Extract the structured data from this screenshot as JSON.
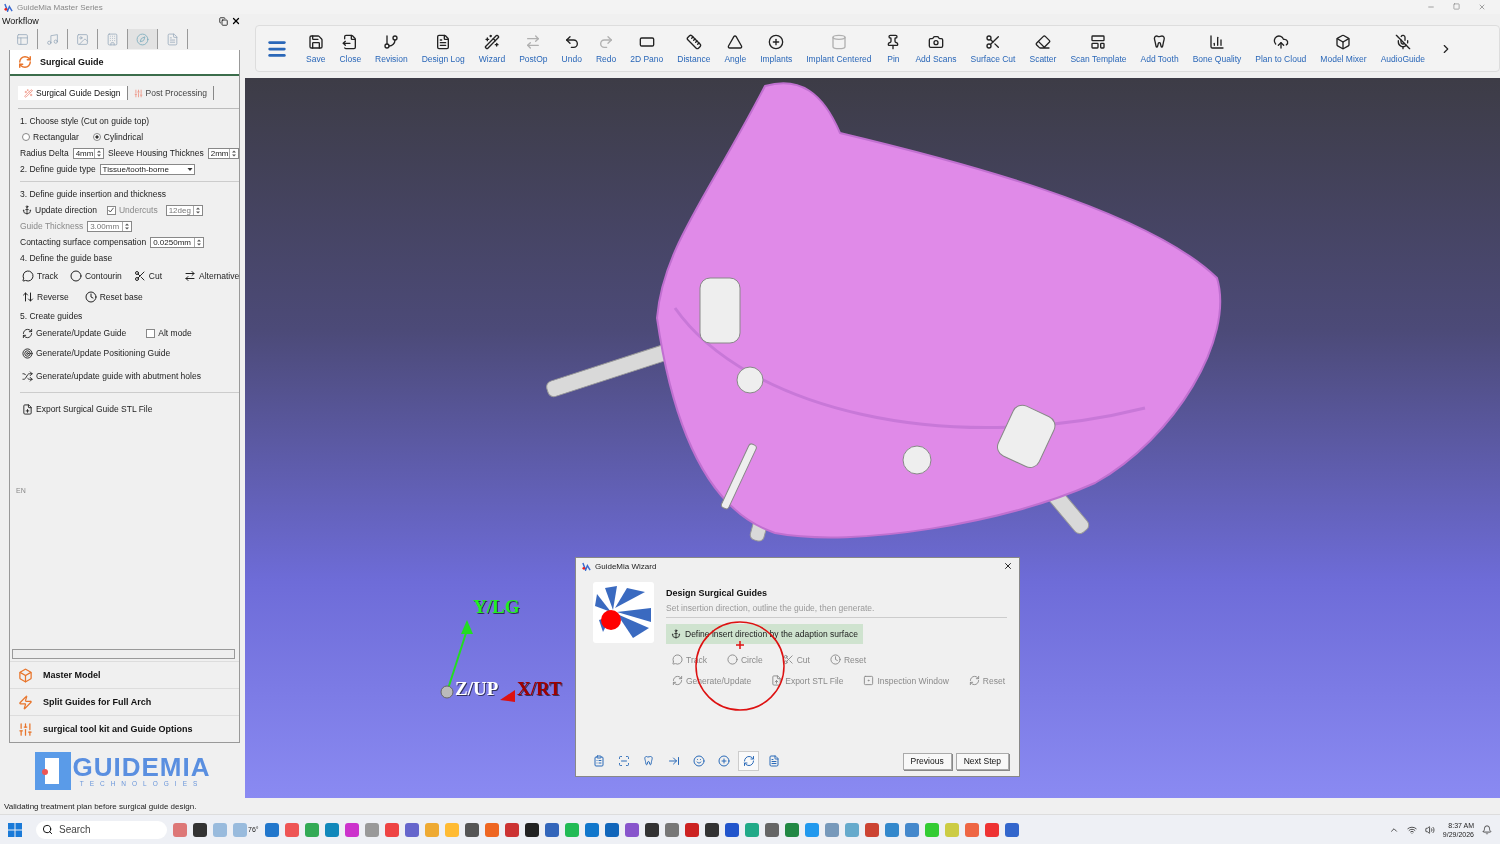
{
  "window": {
    "title": "GuideMia Master Series"
  },
  "workflow": {
    "title": "Workflow",
    "tabs": [
      {
        "selected": false
      },
      {
        "selected": false
      },
      {
        "selected": false
      },
      {
        "selected": false
      },
      {
        "selected": true
      },
      {
        "selected": false
      }
    ],
    "section_title": "Surgical Guide",
    "subtabs": [
      {
        "label": "Surgical Guide Design",
        "selected": true
      },
      {
        "label": "Post Processing",
        "selected": false
      }
    ],
    "step1": {
      "heading": "1. Choose  style (Cut on guide top)",
      "radios": [
        {
          "label": "Rectangular",
          "selected": false
        },
        {
          "label": "Cylindrical",
          "selected": true
        }
      ],
      "radius_delta": {
        "label": "Radius Delta",
        "value": "4mm"
      },
      "sleeve_housing": {
        "label": "Sleeve Housing Thicknes",
        "value": "2mm"
      }
    },
    "step2": {
      "heading": "2. Define guide type",
      "value": "Tissue/tooth-borne"
    },
    "step3": {
      "heading": "3. Define guide insertion and thickness",
      "update_button": "Update direction",
      "undercuts": {
        "label": "Undercuts",
        "checked": true,
        "disabled": true,
        "value": "12deg"
      },
      "guide_thickness": {
        "label": "Guide Thickness",
        "value": "3.00mm",
        "disabled": true
      },
      "compensation": {
        "label": "Contacting surface compensation",
        "value": "0.0250mm"
      }
    },
    "step4": {
      "heading": "4. Define the guide base",
      "tools": [
        {
          "label": "Track"
        },
        {
          "label": "Contourin"
        },
        {
          "label": "Cut"
        },
        {
          "label": "Alternative"
        }
      ],
      "tools2": [
        {
          "label": "Reverse"
        },
        {
          "label": "Reset base"
        }
      ]
    },
    "step5": {
      "heading": "5. Create guides",
      "generate": "Generate/Update Guide",
      "alt_mode": {
        "label": "Alt mode",
        "checked": false
      },
      "positioning": "Generate/Update Positioning Guide",
      "abutment": "Generate/update guide with abutment holes"
    },
    "export": "Export Surgical Guide STL File",
    "language": "EN",
    "sections": [
      "Master Model",
      "Split Guides for Full Arch",
      "surgical tool kit and Guide Options"
    ],
    "logo": {
      "name": "GUIDEMIA",
      "tagline": "TECHNOLOGIES"
    }
  },
  "toolbar": [
    {
      "label": "Save",
      "disabled": false
    },
    {
      "label": "Close",
      "disabled": false
    },
    {
      "label": "Revision",
      "disabled": false
    },
    {
      "label": "Design Log",
      "disabled": false
    },
    {
      "label": "Wizard",
      "disabled": false
    },
    {
      "label": "PostOp",
      "disabled": true
    },
    {
      "label": "Undo",
      "disabled": false
    },
    {
      "label": "Redo",
      "disabled": true
    },
    {
      "label": "2D Pano",
      "disabled": false
    },
    {
      "label": "Distance",
      "disabled": false
    },
    {
      "label": "Angle",
      "disabled": false
    },
    {
      "label": "Implants",
      "disabled": false
    },
    {
      "label": "Implant Centered",
      "disabled": true
    },
    {
      "label": "Pin",
      "disabled": false
    },
    {
      "label": "Add Scans",
      "disabled": false
    },
    {
      "label": "Surface Cut",
      "disabled": false
    },
    {
      "label": "Scatter",
      "disabled": false
    },
    {
      "label": "Scan Template",
      "disabled": false
    },
    {
      "label": "Add Tooth",
      "disabled": false
    },
    {
      "label": "Bone Quality",
      "disabled": false
    },
    {
      "label": "Plan to Cloud",
      "disabled": false
    },
    {
      "label": "Model Mixer",
      "disabled": false
    },
    {
      "label": "AudioGuide",
      "disabled": false
    }
  ],
  "viewport": {
    "axes": {
      "y": "Y/LG",
      "z": "Z/UP",
      "x": "X/RT"
    }
  },
  "wizard": {
    "title": "GuideMia Wizard",
    "heading": "Design Surgical Guides",
    "subtitle": "Set insertion direction, outline the guide, then generate.",
    "action": "Define insert direction by the adaption surface",
    "row1": [
      {
        "label": "Track",
        "disabled": true
      },
      {
        "label": "Circle",
        "disabled": true
      },
      {
        "label": "Cut",
        "disabled": true
      },
      {
        "label": "Reset",
        "disabled": true
      }
    ],
    "row2": [
      {
        "label": "Generate/Update",
        "disabled": true
      },
      {
        "label": "Export STL File",
        "disabled": true
      },
      {
        "label": "Inspection Window",
        "disabled": true
      },
      {
        "label": "Reset",
        "disabled": true
      }
    ],
    "steps": [
      {
        "selected": false
      },
      {
        "selected": false
      },
      {
        "selected": false
      },
      {
        "selected": false
      },
      {
        "selected": false
      },
      {
        "selected": false
      },
      {
        "selected": true
      },
      {
        "selected": false
      }
    ],
    "buttons": [
      "Previous",
      "Next Step"
    ]
  },
  "status_bar": "Validating treatment plan before surgical guide design.",
  "taskbar": {
    "search": "Search",
    "weather": "76°",
    "time": "8:37 AM",
    "date": "9/29/2026"
  }
}
